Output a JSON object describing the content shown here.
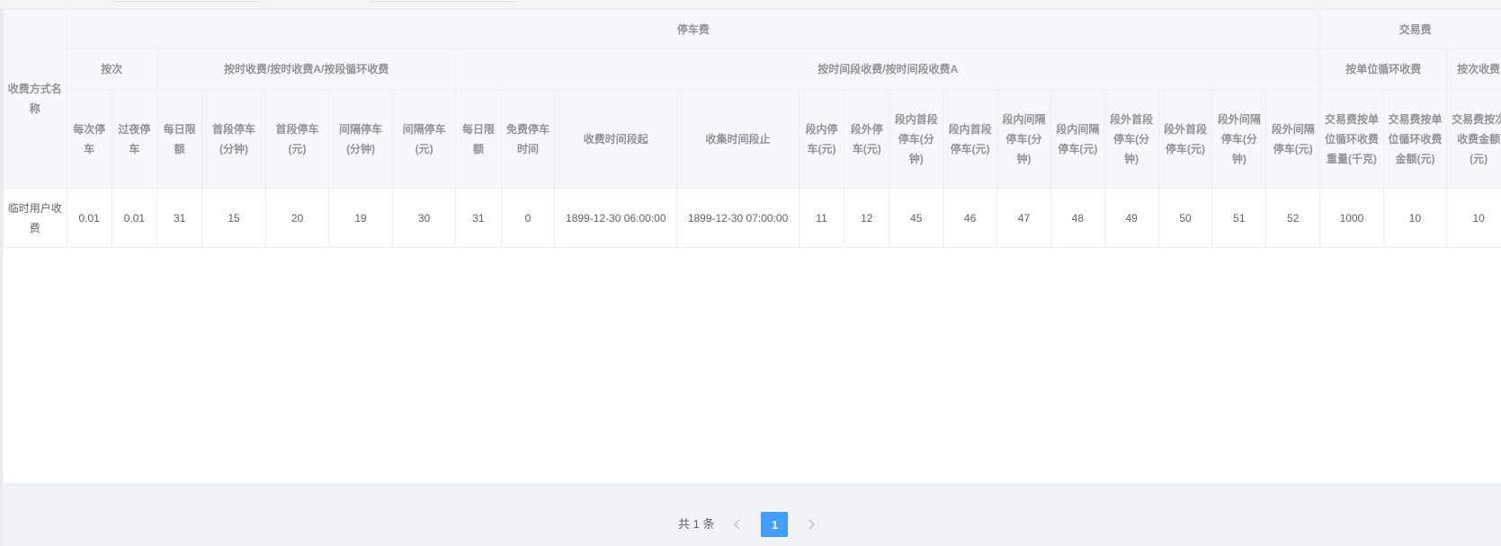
{
  "table": {
    "name_header": "收费方式名称",
    "group_parking": "停车费",
    "group_trade": "交易费",
    "sub_per_time": "按次",
    "sub_hourly": "按时收费/按时收费A/按段循环收费",
    "sub_period": "按时间段收费/按时间段收费A",
    "sub_unit_cycle": "按单位循环收费",
    "sub_per_time_trade": "按次收费",
    "columns": [
      "每次停车",
      "过夜停车",
      "每日限额",
      "首段停车(分钟)",
      "首段停车(元)",
      "间隔停车(分钟)",
      "间隔停车(元)",
      "每日限额",
      "免费停车时间",
      "收费时间段起",
      "收集时间段止",
      "段内停车(元)",
      "段外停车(元)",
      "段内首段停车(分钟)",
      "段内首段停车(元)",
      "段内间隔停车(分钟)",
      "段内间隔停车(元)",
      "段外首段停车(分钟)",
      "段外首段停车(元)",
      "段外间隔停车(分钟)",
      "段外间隔停车(元)",
      "交易费按单位循环收费重量(千克)",
      "交易费按单位循环收费金额(元)",
      "交易费按次收费金额(元)"
    ],
    "rows": [
      {
        "name": "临时用户收费",
        "cells": [
          "0.01",
          "0.01",
          "31",
          "15",
          "20",
          "19",
          "30",
          "31",
          "0",
          "1899-12-30 06:00:00",
          "1899-12-30 07:00:00",
          "11",
          "12",
          "45",
          "46",
          "47",
          "48",
          "49",
          "50",
          "51",
          "52",
          "1000",
          "10",
          "10"
        ]
      }
    ]
  },
  "pagination": {
    "total": "共 1 条",
    "prev_icon": "chevron-left-icon",
    "current_page": "1",
    "next_icon": "chevron-right-icon"
  },
  "colors": {
    "accent": "#409eff",
    "header_bg": "#f5f7fa",
    "border": "#ebeef5"
  }
}
